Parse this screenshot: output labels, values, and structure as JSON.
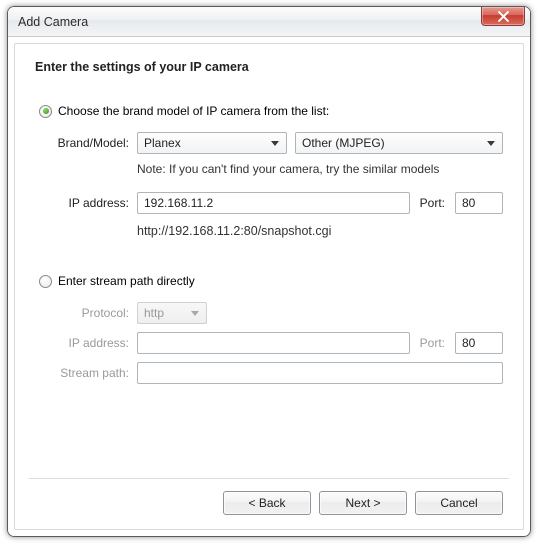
{
  "window": {
    "title": "Add Camera"
  },
  "heading": "Enter the settings of your IP camera",
  "optionA": {
    "checked": true,
    "label": "Choose the brand model of IP camera from the list:",
    "brand_model_label": "Brand/Model:",
    "brand": "Planex",
    "model": "Other (MJPEG)",
    "note": "Note: If you can't find your camera, try the similar models",
    "ip_label": "IP address:",
    "ip_value": "192.168.11.2",
    "port_label": "Port:",
    "port_value": "80",
    "url": "http://192.168.11.2:80/snapshot.cgi"
  },
  "optionB": {
    "checked": false,
    "label": "Enter stream path directly",
    "protocol_label": "Protocol:",
    "protocol_value": "http",
    "ip_label": "IP address:",
    "ip_value": "",
    "port_label": "Port:",
    "port_value": "80",
    "stream_label": "Stream path:",
    "stream_value": ""
  },
  "buttons": {
    "back": "< Back",
    "next": "Next >",
    "cancel": "Cancel"
  }
}
